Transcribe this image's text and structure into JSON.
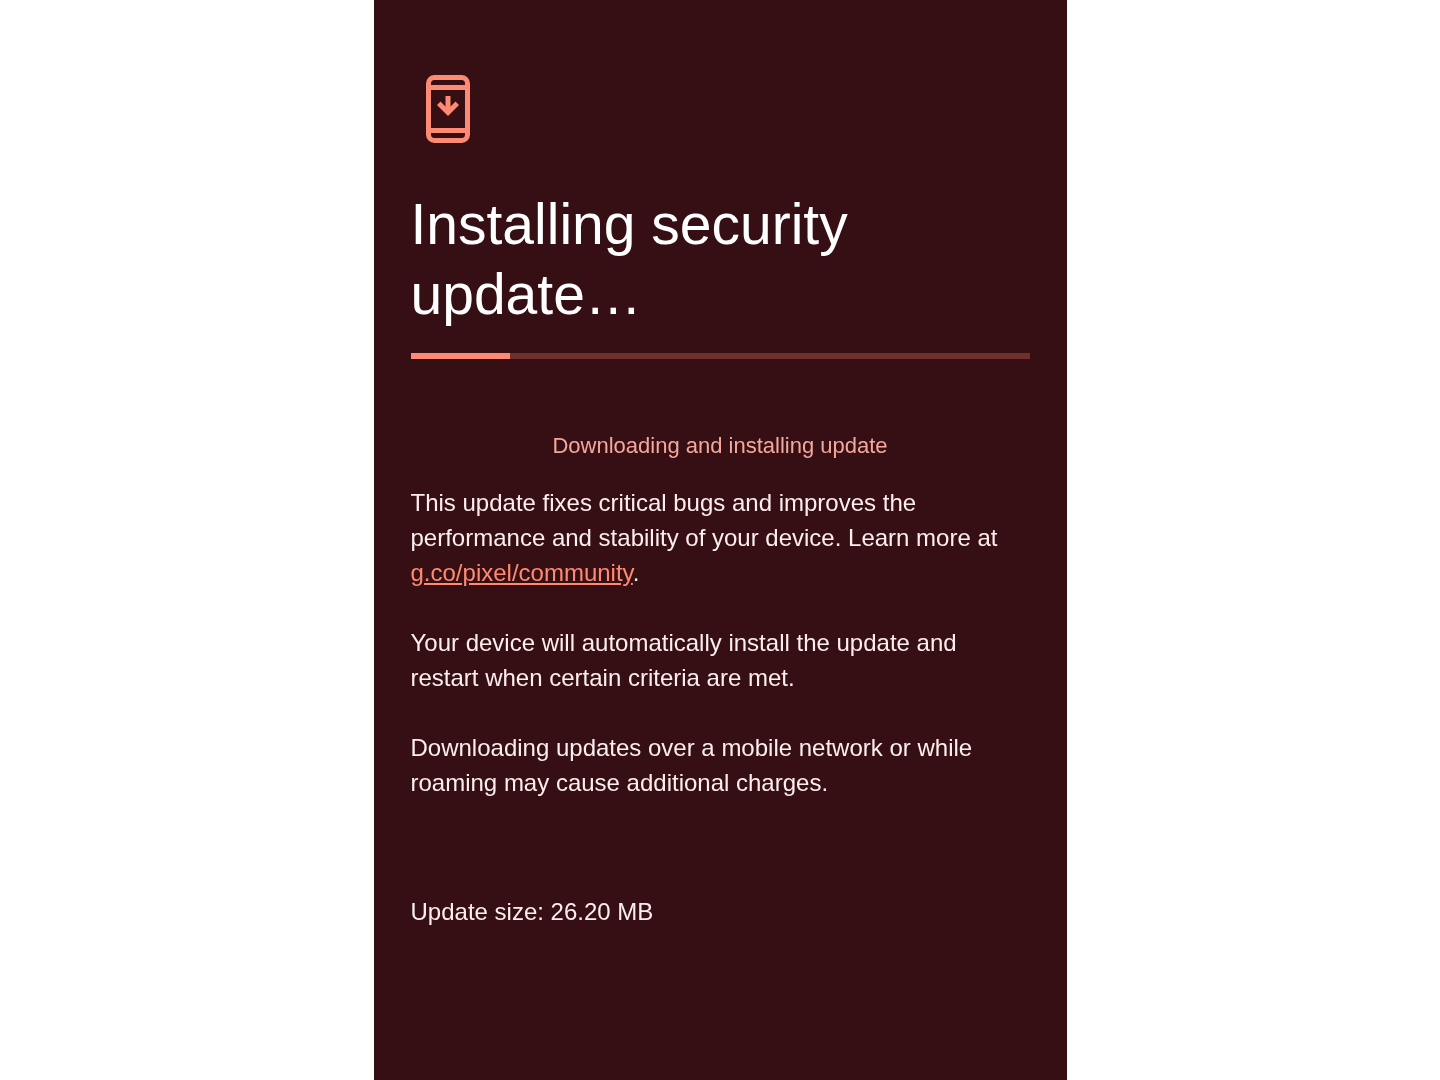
{
  "title": "Installing security update…",
  "progress": {
    "level": 0.16
  },
  "status": "Downloading and installing update",
  "paragraphs": [
    {
      "kind": "link",
      "text": "This update fixes critical bugs and improves the performance and stability of your device. Learn more at ",
      "link": "g.co/pixel/community",
      "after": "."
    },
    {
      "kind": "plain",
      "text": "Your device will automatically install the update and restart when certain criteria are met."
    },
    {
      "kind": "plain",
      "text": "Downloading updates over a mobile network or while roaming may cause additional charges."
    }
  ],
  "update_size": "Update size: 26.20 MB"
}
